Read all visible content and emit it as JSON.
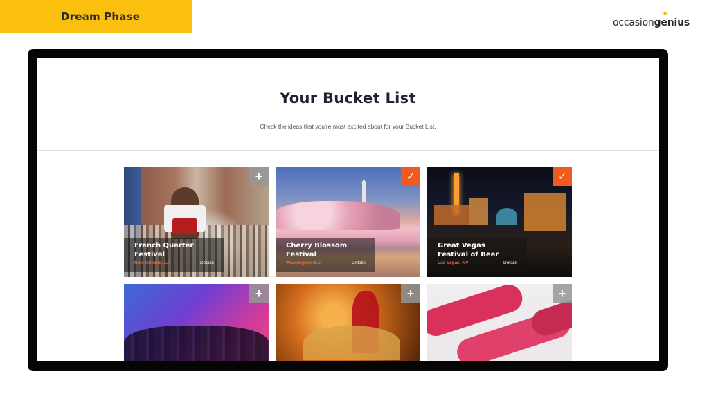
{
  "phase_banner": {
    "label": "Dream Phase"
  },
  "logo": {
    "part1": "occasion",
    "part2": "genius"
  },
  "page": {
    "title": "Your Bucket List",
    "subtitle": "Check the ideas that you’re most excited about for your Bucket List."
  },
  "cards": [
    {
      "name": "French Quarter Festival",
      "location": "New Orleans, LA",
      "details_label": "Details",
      "selected": false,
      "toggle_icon": "+"
    },
    {
      "name": "Cherry Blossom Festival",
      "location": "Washington D.C.",
      "details_label": "Details",
      "selected": true,
      "toggle_icon": "✓"
    },
    {
      "name": "Great Vegas Festival of Beer",
      "location": "Las Vegas, NV",
      "details_label": "Details",
      "selected": true,
      "toggle_icon": "✓"
    },
    {
      "name": "",
      "location": "",
      "details_label": "",
      "selected": false,
      "toggle_icon": "+"
    },
    {
      "name": "",
      "location": "",
      "details_label": "",
      "selected": false,
      "toggle_icon": "+"
    },
    {
      "name": "",
      "location": "",
      "details_label": "",
      "selected": false,
      "toggle_icon": "+"
    }
  ],
  "colors": {
    "banner": "#fbbf0e",
    "accent": "#f05a22",
    "location_text": "#ff6a2c",
    "frame": "#050505"
  }
}
